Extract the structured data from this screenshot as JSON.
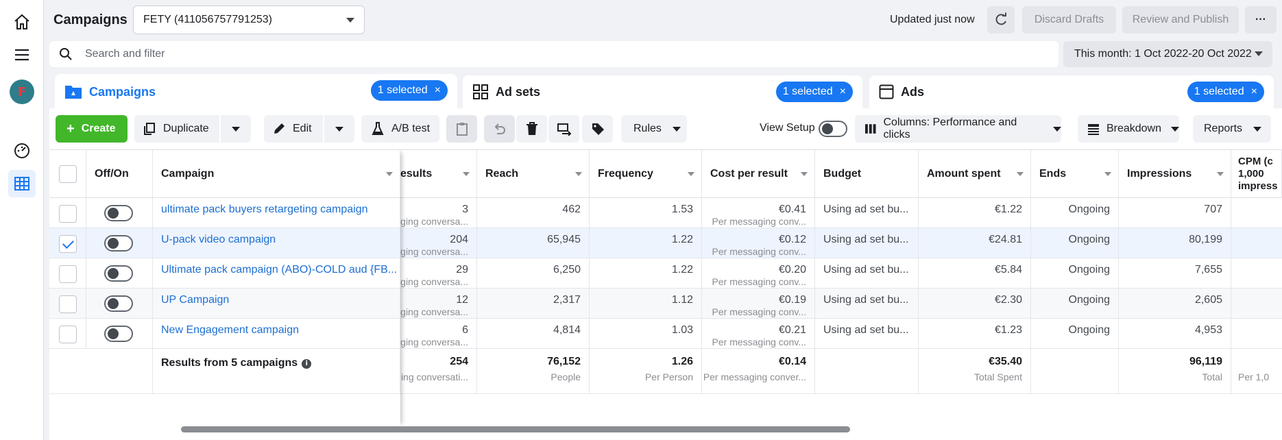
{
  "header": {
    "title": "Campaigns",
    "account": "FETY (411056757791253)",
    "updated": "Updated just now",
    "discard_label": "Discard Drafts",
    "publish_label": "Review and Publish",
    "more_label": "···"
  },
  "search": {
    "placeholder": "Search and filter"
  },
  "date_range": "This month: 1 Oct 2022-20 Oct 2022",
  "tabs": [
    {
      "label": "Campaigns",
      "selected": "1 selected",
      "close": "×"
    },
    {
      "label": "Ad sets",
      "selected": "1 selected",
      "close": "×"
    },
    {
      "label": "Ads",
      "selected": "1 selected",
      "close": "×"
    }
  ],
  "toolbar": {
    "create": "Create",
    "create_plus": "+",
    "duplicate": "Duplicate",
    "edit": "Edit",
    "ab_test": "A/B test",
    "rules": "Rules",
    "view_setup": "View Setup",
    "columns": "Columns: Performance and clicks",
    "breakdown": "Breakdown",
    "reports": "Reports"
  },
  "table": {
    "headers": {
      "off_on": "Off/On",
      "campaign": "Campaign",
      "results": "esults",
      "reach": "Reach",
      "frequency": "Frequency",
      "cost_per_result": "Cost per result",
      "budget": "Budget",
      "amount_spent": "Amount spent",
      "ends": "Ends",
      "impressions": "Impressions",
      "cpm": "CPM (c 1,000 impress"
    },
    "rows": [
      {
        "campaign": "ultimate pack buyers retargeting campaign",
        "results": "3",
        "results_sub": "aging conversa...",
        "reach": "462",
        "frequency": "1.53",
        "cpr": "€0.41",
        "cpr_sub": "Per messaging conv...",
        "budget": "Using ad set bu...",
        "spent": "€1.22",
        "ends": "Ongoing",
        "impressions": "707",
        "checked": "no"
      },
      {
        "campaign": "U-pack video campaign",
        "results": "204",
        "results_sub": "aging conversa...",
        "reach": "65,945",
        "frequency": "1.22",
        "cpr": "€0.12",
        "cpr_sub": "Per messaging conv...",
        "budget": "Using ad set bu...",
        "spent": "€24.81",
        "ends": "Ongoing",
        "impressions": "80,199",
        "checked": "yes"
      },
      {
        "campaign": "Ultimate pack campaign (ABO)-COLD aud {FB...",
        "results": "29",
        "results_sub": "aging conversa...",
        "reach": "6,250",
        "frequency": "1.22",
        "cpr": "€0.20",
        "cpr_sub": "Per messaging conv...",
        "budget": "Using ad set bu...",
        "spent": "€5.84",
        "ends": "Ongoing",
        "impressions": "7,655",
        "checked": "no"
      },
      {
        "campaign": "UP Campaign",
        "results": "12",
        "results_sub": "aging conversa...",
        "reach": "2,317",
        "frequency": "1.12",
        "cpr": "€0.19",
        "cpr_sub": "Per messaging conv...",
        "budget": "Using ad set bu...",
        "spent": "€2.30",
        "ends": "Ongoing",
        "impressions": "2,605",
        "checked": "no"
      },
      {
        "campaign": "New Engagement campaign",
        "results": "6",
        "results_sub": "aging conversa...",
        "reach": "4,814",
        "frequency": "1.03",
        "cpr": "€0.21",
        "cpr_sub": "Per messaging conv...",
        "budget": "Using ad set bu...",
        "spent": "€1.23",
        "ends": "Ongoing",
        "impressions": "4,953",
        "checked": "no"
      }
    ],
    "totals": {
      "label": "Results from 5 campaigns",
      "info": "i",
      "results": "254",
      "results_sub": "aging conversati...",
      "reach": "76,152",
      "reach_sub": "People",
      "frequency": "1.26",
      "frequency_sub": "Per Person",
      "cpr": "€0.14",
      "cpr_sub": "Per messaging conver...",
      "spent": "€35.40",
      "spent_sub": "Total Spent",
      "impressions": "96,119",
      "impressions_sub": "Total",
      "cpm_sub": "Per 1,0"
    }
  },
  "colors": {
    "accent": "#1877f2",
    "create": "#42b72a",
    "link": "#1c6fd4"
  },
  "icons": [
    "home-icon",
    "menu-icon",
    "ads-manager-icon",
    "gauge-icon",
    "table-icon",
    "search-icon",
    "refresh-icon",
    "folder-icon",
    "grid-icon",
    "ad-window-icon",
    "copy-icon",
    "pencil-icon",
    "flask-icon",
    "clipboard-icon",
    "undo-icon",
    "trash-icon",
    "swap-icon",
    "tag-icon",
    "columns-icon",
    "breakdown-icon"
  ]
}
